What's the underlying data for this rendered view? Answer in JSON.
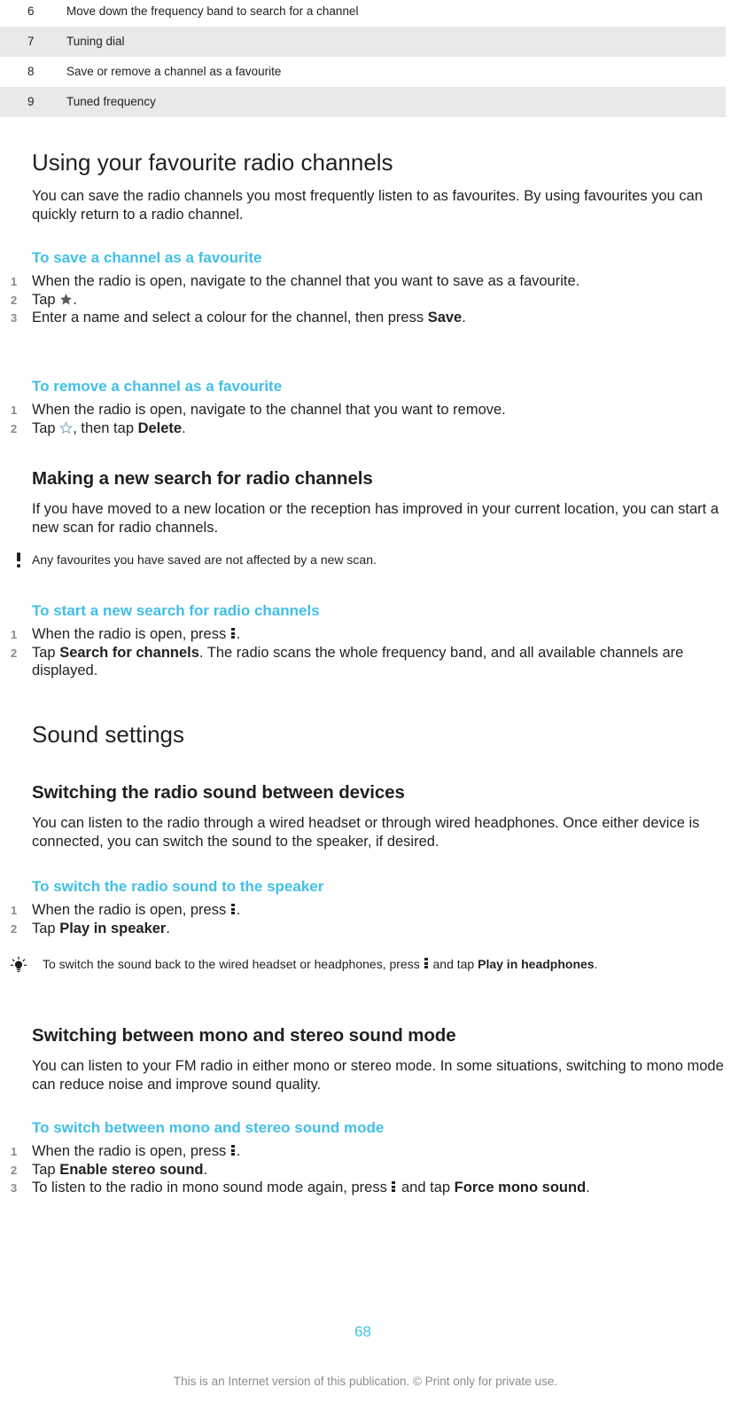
{
  "table": {
    "rows": [
      {
        "num": "6",
        "desc": "Move down the frequency band to search for a channel",
        "shaded": false
      },
      {
        "num": "7",
        "desc": "Tuning dial",
        "shaded": true
      },
      {
        "num": "8",
        "desc": "Save or remove a channel as a favourite",
        "shaded": false
      },
      {
        "num": "9",
        "desc": "Tuned frequency",
        "shaded": true
      }
    ]
  },
  "sections": {
    "favourites": {
      "heading": "Using your favourite radio channels",
      "intro": "You can save the radio channels you most frequently listen to as favourites. By using favourites you can quickly return to a radio channel.",
      "save_proc": {
        "title": "To save a channel as a favourite",
        "step1": "When the radio is open, navigate to the channel that you want to save as a favourite.",
        "step2_pre": "Tap ",
        "step2_post": ".",
        "step2_icon": "star-filled-icon",
        "step3_pre": "Enter a name and select a colour for the channel, then press ",
        "step3_bold": "Save",
        "step3_post": "."
      },
      "remove_proc": {
        "title": "To remove a channel as a favourite",
        "step1": "When the radio is open, navigate to the channel that you want to remove.",
        "step2_pre": "Tap ",
        "step2_mid": ", then tap ",
        "step2_bold": "Delete",
        "step2_post": ".",
        "step2_icon": "star-outline-icon"
      }
    },
    "new_search": {
      "heading": "Making a new search for radio channels",
      "intro": "If you have moved to a new location or the reception has improved in your current location, you can start a new scan for radio channels.",
      "note": {
        "icon": "exclamation-icon",
        "text": "Any favourites you have saved are not affected by a new scan."
      },
      "proc": {
        "title": "To start a new search for radio channels",
        "step1_pre": "When the radio is open, press ",
        "step1_post": ".",
        "step1_icon": "kebab-menu-icon",
        "step2_pre": "Tap ",
        "step2_bold": "Search for channels",
        "step2_post": ". The radio scans the whole frequency band, and all available channels are displayed."
      }
    },
    "sound_settings": {
      "heading": "Sound settings",
      "switching_devices": {
        "heading": "Switching the radio sound between devices",
        "intro": "You can listen to the radio through a wired headset or through wired headphones. Once either device is connected, you can switch the sound to the speaker, if desired.",
        "proc": {
          "title": "To switch the radio sound to the speaker",
          "step1_pre": "When the radio is open, press ",
          "step1_post": ".",
          "step1_icon": "kebab-menu-icon",
          "step2_pre": "Tap ",
          "step2_bold": "Play in speaker",
          "step2_post": "."
        },
        "tip": {
          "icon": "lightbulb-icon",
          "pre": "To switch the sound back to the wired headset or headphones, press ",
          "mid": " and tap ",
          "bold": "Play in headphones",
          "post": "."
        }
      },
      "mono_stereo": {
        "heading": "Switching between mono and stereo sound mode",
        "intro": "You can listen to your FM radio in either mono or stereo mode. In some situations, switching to mono mode can reduce noise and improve sound quality.",
        "proc": {
          "title": "To switch between mono and stereo sound mode",
          "step1_pre": "When the radio is open, press ",
          "step1_post": ".",
          "step2_pre": "Tap ",
          "step2_bold": "Enable stereo sound",
          "step2_post": ".",
          "step3_pre": "To listen to the radio in mono sound mode again, press ",
          "step3_mid": " and tap ",
          "step3_bold": "Force mono sound",
          "step3_post": "."
        }
      }
    }
  },
  "footer": {
    "page_number": "68",
    "notice": "This is an Internet version of this publication. © Print only for private use."
  },
  "colors": {
    "accent": "#41bfe8",
    "text": "#231f20",
    "row_shade": "#e9e9e9",
    "muted": "#8c8c8c"
  }
}
